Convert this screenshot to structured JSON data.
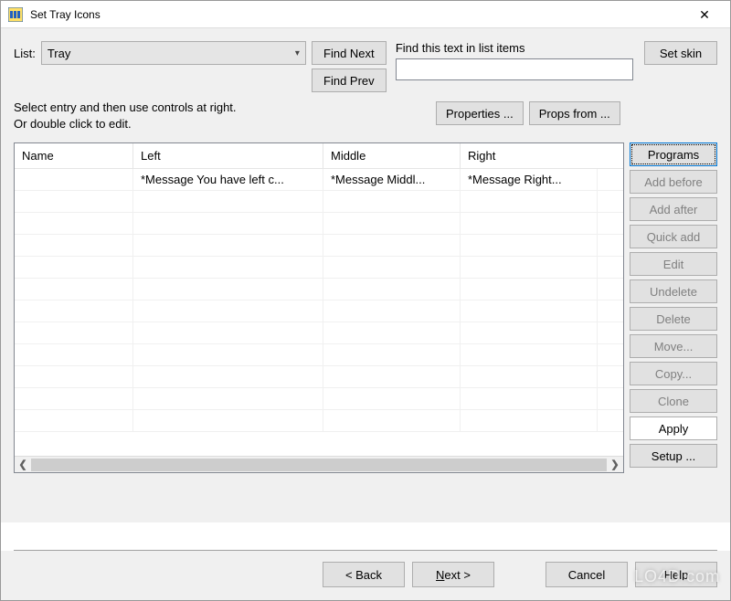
{
  "window": {
    "title": "Set Tray Icons"
  },
  "top": {
    "list_label": "List:",
    "list_value": "Tray",
    "find_next": "Find Next",
    "find_prev": "Find Prev",
    "find_label": "Find this text in list items",
    "find_value": "",
    "set_skin": "Set skin"
  },
  "instructions": {
    "line1": "Select entry and then use controls at right.",
    "line2": "Or double click to edit."
  },
  "props": {
    "properties": "Properties ...",
    "props_from": "Props from ..."
  },
  "grid": {
    "columns": [
      "Name",
      "Left",
      "Middle",
      "Right"
    ],
    "rows": [
      {
        "name": "",
        "left": "*Message You have left c...",
        "middle": "*Message Middl...",
        "right": "*Message Right..."
      }
    ]
  },
  "side": {
    "programs": "Programs",
    "add_before": "Add before",
    "add_after": "Add after",
    "quick_add": "Quick add",
    "edit": "Edit",
    "undelete": "Undelete",
    "delete": "Delete",
    "move": "Move...",
    "copy": "Copy...",
    "clone": "Clone",
    "apply": "Apply",
    "setup": "Setup ..."
  },
  "footer": {
    "back": "< Back",
    "next": "Next >",
    "cancel": "Cancel",
    "help": "Help"
  },
  "watermark": "LO4D.com"
}
